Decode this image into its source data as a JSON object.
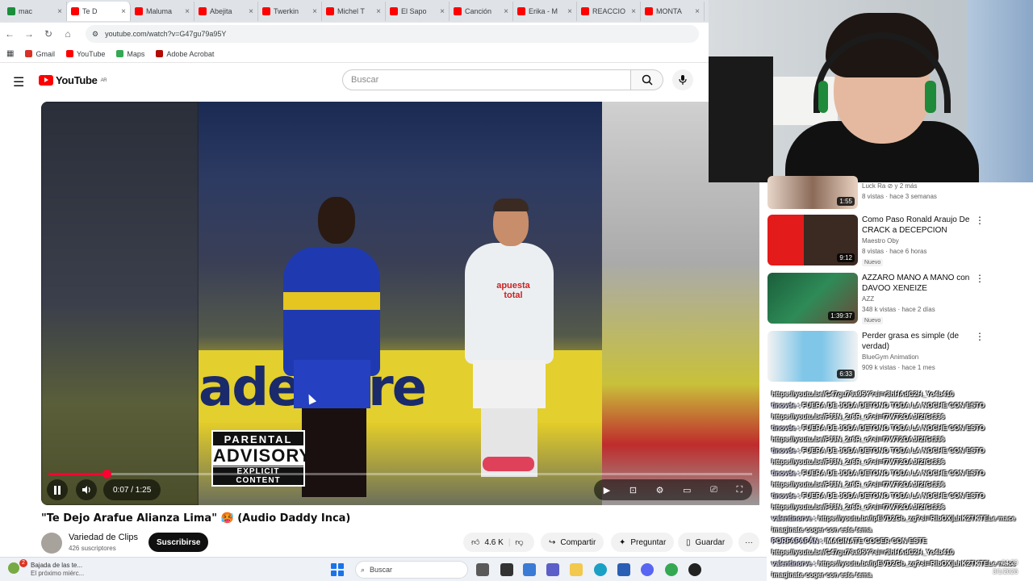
{
  "browser": {
    "tabs": [
      {
        "label": "mac",
        "color": "#1a8e3a"
      },
      {
        "label": "Te D",
        "color": "#ff0000",
        "active": true
      },
      {
        "label": "Maluma",
        "color": "#ff0000"
      },
      {
        "label": "Abejita",
        "color": "#ff0000"
      },
      {
        "label": "Twerkin",
        "color": "#ff0000"
      },
      {
        "label": "Michel T",
        "color": "#ff0000"
      },
      {
        "label": "El Sapo",
        "color": "#ff0000"
      },
      {
        "label": "Canción",
        "color": "#ff0000"
      },
      {
        "label": "Erika - M",
        "color": "#ff0000"
      },
      {
        "label": "REACCIO",
        "color": "#ff0000"
      },
      {
        "label": "MONTA",
        "color": "#ff0000"
      }
    ],
    "url": "youtube.com/watch?v=G47gu79a95Y",
    "bookmarks": [
      {
        "label": "Gmail",
        "color": "#d93025"
      },
      {
        "label": "YouTube",
        "color": "#ff0000"
      },
      {
        "label": "Maps",
        "color": "#34a853"
      },
      {
        "label": "Adobe Acrobat",
        "color": "#b30b00"
      }
    ]
  },
  "youtube": {
    "logo_text": "YouTube",
    "logo_region": "AR",
    "search_placeholder": "Buscar",
    "player": {
      "advisory_line1": "PARENTAL",
      "advisory_line2": "ADVISORY",
      "advisory_line3": "EXPLICIT CONTENT",
      "banner_text": "adelibre",
      "sponsor_text": "apuesta total",
      "time_text": "0:07 / 1:25",
      "progress": 0.082
    },
    "video_title": "\"Te Dejo Arafue Alianza Lima\" 🥵 (Audio Daddy Inca)",
    "channel": {
      "name": "Variedad de Clips",
      "subs": "426 suscriptores",
      "subscribe_label": "Suscribirse"
    },
    "actions": {
      "likes": "4.6 K",
      "share": "Compartir",
      "ask": "Preguntar",
      "save": "Guardar"
    },
    "recommendations": [
      {
        "title": "",
        "channel": "Luck Ra ⊘ y 2 más",
        "meta": "8 vistas · hace 3 semanas",
        "duration": "1:55",
        "new": false
      },
      {
        "title": "Como Paso Ronald Araujo De CRACK a DECEPCION",
        "channel": "Maestro Oby",
        "meta": "8 vistas · hace 6 horas",
        "duration": "9:12",
        "new": true,
        "new_label": "Nuevo"
      },
      {
        "title": "AZZARO MANO A MANO con DAVOO XENEIZE",
        "channel": "AZZ",
        "meta": "348 k vistas · hace 2 días",
        "duration": "1:39:37",
        "new": true,
        "new_label": "Nuevo"
      },
      {
        "title": "Perder grasa es simple (de verdad)",
        "channel": "BlueGym Animation",
        "meta": "909 k vistas · hace 1 mes",
        "duration": "6:33",
        "new": false
      }
    ]
  },
  "chat": [
    {
      "user": "",
      "text": "https://youtu.be/G47gu79a95Y?si=r3hHAdC2H_Yo4b410"
    },
    {
      "user": "tinovde : ",
      "text": "FUERA DE JODA DETONO TODA LA NOCHE CON ESTO"
    },
    {
      "user": "",
      "text": "https://youtu.be/FJ3N_2r6R_o?si=f7WT2OAJf2fGt336"
    },
    {
      "user": "tinovde : ",
      "text": "FUERA DE JODA DETONO TODA LA NOCHE CON ESTO"
    },
    {
      "user": "",
      "text": "https://youtu.be/FJ3N_2r6R_o?si=f7WT2OAJf2fGt336"
    },
    {
      "user": "tinovde : ",
      "text": "FUERA DE JODA DETONO TODA LA NOCHE CON ESTO"
    },
    {
      "user": "",
      "text": "https://youtu.be/FJ3N_2r6R_o?si=f7WT2OAJf2fGt336"
    },
    {
      "user": "tinovde : ",
      "text": "FUERA DE JODA DETONO TODA LA NOCHE CON ESTO"
    },
    {
      "user": "",
      "text": "https://youtu.be/FJ3N_2r6R_o?si=f7WT2OAJf2fGt336"
    },
    {
      "user": "tinovde : ",
      "text": "FUERA DE JODA DETONO TODA LA NOCHE CON ESTO"
    },
    {
      "user": "",
      "text": "https://youtu.be/FJ3N_2r6R_o?si=f7WT2OAJf2fGt336"
    },
    {
      "user": "valentinorve : ",
      "text": "https://youtu.be/lpEVD2Gb_zg?si=RIbOXjLhK2TKTELe mace"
    },
    {
      "user": "",
      "text": "imaginate coger con este tema"
    },
    {
      "user": "PORFAPAPÁN : ",
      "text": "IMAGINATE COGER CON ESTE"
    },
    {
      "user": "",
      "text": "https://youtu.be/G47gu79a95Y?si=r3hHAdC2H_Yo4b410"
    },
    {
      "user": "valentinorve : ",
      "text": "https://youtu.be/lpEVD2Gb_zg?si=RIbOXjLhK2TKTELe mace"
    },
    {
      "user": "",
      "text": "imaginate coger con este tema"
    }
  ],
  "taskbar": {
    "weather_line1": "Bajada de las te...",
    "weather_line2": "El próximo miérc...",
    "weather_badge": "2",
    "search_label": "Buscar",
    "clock_time": "04:29",
    "clock_date": "3/1/2026"
  }
}
